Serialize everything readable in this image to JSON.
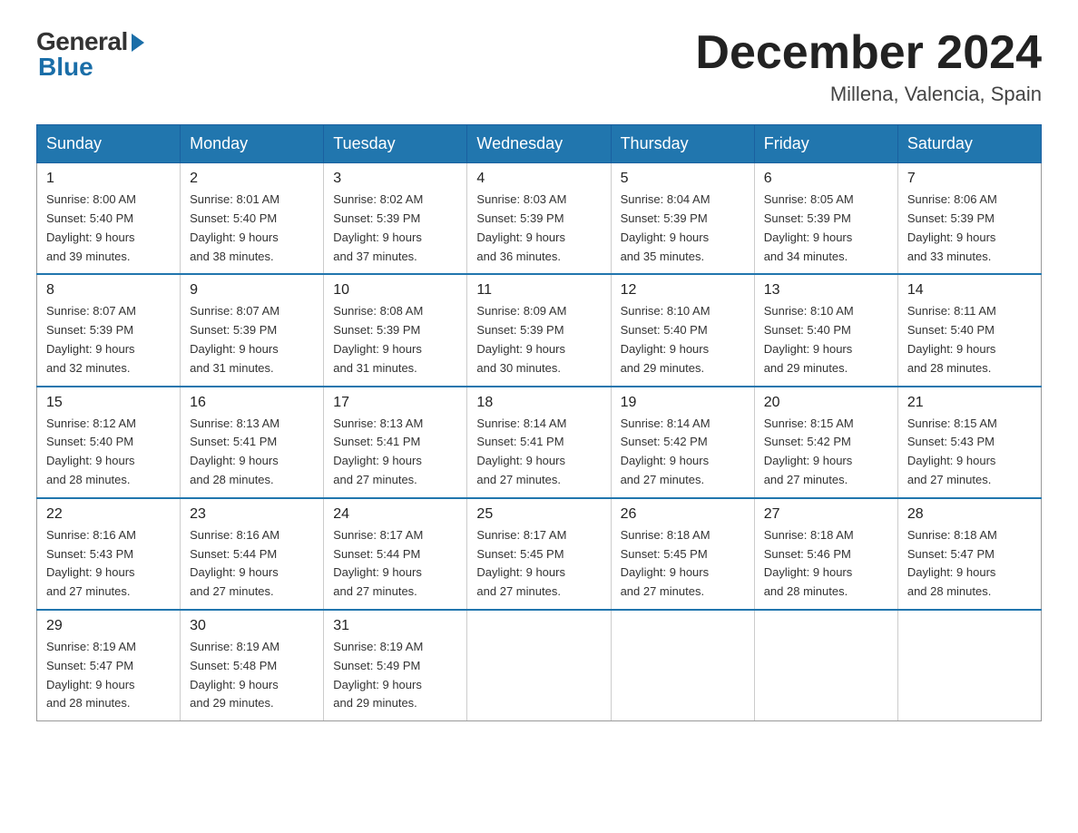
{
  "logo": {
    "general": "General",
    "blue": "Blue"
  },
  "title": {
    "month_year": "December 2024",
    "location": "Millena, Valencia, Spain"
  },
  "weekdays": [
    "Sunday",
    "Monday",
    "Tuesday",
    "Wednesday",
    "Thursday",
    "Friday",
    "Saturday"
  ],
  "weeks": [
    [
      {
        "day": "1",
        "sunrise": "8:00 AM",
        "sunset": "5:40 PM",
        "daylight": "9 hours and 39 minutes."
      },
      {
        "day": "2",
        "sunrise": "8:01 AM",
        "sunset": "5:40 PM",
        "daylight": "9 hours and 38 minutes."
      },
      {
        "day": "3",
        "sunrise": "8:02 AM",
        "sunset": "5:39 PM",
        "daylight": "9 hours and 37 minutes."
      },
      {
        "day": "4",
        "sunrise": "8:03 AM",
        "sunset": "5:39 PM",
        "daylight": "9 hours and 36 minutes."
      },
      {
        "day": "5",
        "sunrise": "8:04 AM",
        "sunset": "5:39 PM",
        "daylight": "9 hours and 35 minutes."
      },
      {
        "day": "6",
        "sunrise": "8:05 AM",
        "sunset": "5:39 PM",
        "daylight": "9 hours and 34 minutes."
      },
      {
        "day": "7",
        "sunrise": "8:06 AM",
        "sunset": "5:39 PM",
        "daylight": "9 hours and 33 minutes."
      }
    ],
    [
      {
        "day": "8",
        "sunrise": "8:07 AM",
        "sunset": "5:39 PM",
        "daylight": "9 hours and 32 minutes."
      },
      {
        "day": "9",
        "sunrise": "8:07 AM",
        "sunset": "5:39 PM",
        "daylight": "9 hours and 31 minutes."
      },
      {
        "day": "10",
        "sunrise": "8:08 AM",
        "sunset": "5:39 PM",
        "daylight": "9 hours and 31 minutes."
      },
      {
        "day": "11",
        "sunrise": "8:09 AM",
        "sunset": "5:39 PM",
        "daylight": "9 hours and 30 minutes."
      },
      {
        "day": "12",
        "sunrise": "8:10 AM",
        "sunset": "5:40 PM",
        "daylight": "9 hours and 29 minutes."
      },
      {
        "day": "13",
        "sunrise": "8:10 AM",
        "sunset": "5:40 PM",
        "daylight": "9 hours and 29 minutes."
      },
      {
        "day": "14",
        "sunrise": "8:11 AM",
        "sunset": "5:40 PM",
        "daylight": "9 hours and 28 minutes."
      }
    ],
    [
      {
        "day": "15",
        "sunrise": "8:12 AM",
        "sunset": "5:40 PM",
        "daylight": "9 hours and 28 minutes."
      },
      {
        "day": "16",
        "sunrise": "8:13 AM",
        "sunset": "5:41 PM",
        "daylight": "9 hours and 28 minutes."
      },
      {
        "day": "17",
        "sunrise": "8:13 AM",
        "sunset": "5:41 PM",
        "daylight": "9 hours and 27 minutes."
      },
      {
        "day": "18",
        "sunrise": "8:14 AM",
        "sunset": "5:41 PM",
        "daylight": "9 hours and 27 minutes."
      },
      {
        "day": "19",
        "sunrise": "8:14 AM",
        "sunset": "5:42 PM",
        "daylight": "9 hours and 27 minutes."
      },
      {
        "day": "20",
        "sunrise": "8:15 AM",
        "sunset": "5:42 PM",
        "daylight": "9 hours and 27 minutes."
      },
      {
        "day": "21",
        "sunrise": "8:15 AM",
        "sunset": "5:43 PM",
        "daylight": "9 hours and 27 minutes."
      }
    ],
    [
      {
        "day": "22",
        "sunrise": "8:16 AM",
        "sunset": "5:43 PM",
        "daylight": "9 hours and 27 minutes."
      },
      {
        "day": "23",
        "sunrise": "8:16 AM",
        "sunset": "5:44 PM",
        "daylight": "9 hours and 27 minutes."
      },
      {
        "day": "24",
        "sunrise": "8:17 AM",
        "sunset": "5:44 PM",
        "daylight": "9 hours and 27 minutes."
      },
      {
        "day": "25",
        "sunrise": "8:17 AM",
        "sunset": "5:45 PM",
        "daylight": "9 hours and 27 minutes."
      },
      {
        "day": "26",
        "sunrise": "8:18 AM",
        "sunset": "5:45 PM",
        "daylight": "9 hours and 27 minutes."
      },
      {
        "day": "27",
        "sunrise": "8:18 AM",
        "sunset": "5:46 PM",
        "daylight": "9 hours and 28 minutes."
      },
      {
        "day": "28",
        "sunrise": "8:18 AM",
        "sunset": "5:47 PM",
        "daylight": "9 hours and 28 minutes."
      }
    ],
    [
      {
        "day": "29",
        "sunrise": "8:19 AM",
        "sunset": "5:47 PM",
        "daylight": "9 hours and 28 minutes."
      },
      {
        "day": "30",
        "sunrise": "8:19 AM",
        "sunset": "5:48 PM",
        "daylight": "9 hours and 29 minutes."
      },
      {
        "day": "31",
        "sunrise": "8:19 AM",
        "sunset": "5:49 PM",
        "daylight": "9 hours and 29 minutes."
      },
      null,
      null,
      null,
      null
    ]
  ],
  "labels": {
    "sunrise": "Sunrise:",
    "sunset": "Sunset:",
    "daylight": "Daylight:"
  }
}
